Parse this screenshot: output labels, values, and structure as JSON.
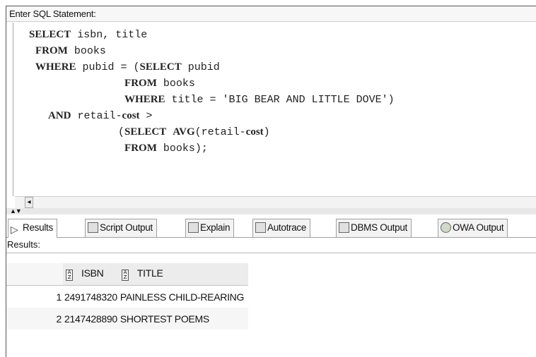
{
  "editor": {
    "header": "Enter SQL Statement:",
    "lines": [
      [
        {
          "kw": "SELECT"
        },
        {
          "t": " isbn, title"
        }
      ],
      [
        {
          "t": " "
        },
        {
          "kw": "FROM"
        },
        {
          "t": " books"
        }
      ],
      [
        {
          "t": " "
        },
        {
          "kw": "WHERE"
        },
        {
          "t": " pubid = ("
        },
        {
          "kw": "SELECT"
        },
        {
          "t": " pubid"
        }
      ],
      [
        {
          "t": "               "
        },
        {
          "kw": "FROM"
        },
        {
          "t": " books"
        }
      ],
      [
        {
          "t": "               "
        },
        {
          "kw": "WHERE"
        },
        {
          "t": " title = 'BIG BEAR AND LITTLE DOVE')"
        }
      ],
      [
        {
          "t": "   "
        },
        {
          "kw": "AND"
        },
        {
          "t": " retail-"
        },
        {
          "kw": "cost"
        },
        {
          "t": " >"
        }
      ],
      [
        {
          "t": "              ("
        },
        {
          "kw": "SELECT"
        },
        {
          "t": " "
        },
        {
          "kw": "AVG"
        },
        {
          "t": "(retail-"
        },
        {
          "kw": "cost"
        },
        {
          "t": ")"
        }
      ],
      [
        {
          "t": "               "
        },
        {
          "kw": "FROM"
        },
        {
          "t": " books);"
        }
      ]
    ]
  },
  "tabs": [
    {
      "label": "Results",
      "icon": "play-icon"
    },
    {
      "label": "Script Output",
      "icon": "script-icon"
    },
    {
      "label": "Explain",
      "icon": "explain-icon"
    },
    {
      "label": "Autotrace",
      "icon": "autotrace-icon"
    },
    {
      "label": "DBMS Output",
      "icon": "dbms-icon"
    },
    {
      "label": "OWA Output",
      "icon": "globe-icon"
    }
  ],
  "results": {
    "label": "Results:",
    "columns": [
      "ISBN",
      "TITLE"
    ],
    "rows": [
      {
        "num": "1",
        "isbn": "2491748320",
        "title": "PAINLESS CHILD-REARING"
      },
      {
        "num": "2",
        "isbn": "2147428890",
        "title": "SHORTEST POEMS"
      }
    ]
  },
  "scroll": {
    "left_arrow": "◂",
    "split_arrows": "▲▼"
  }
}
